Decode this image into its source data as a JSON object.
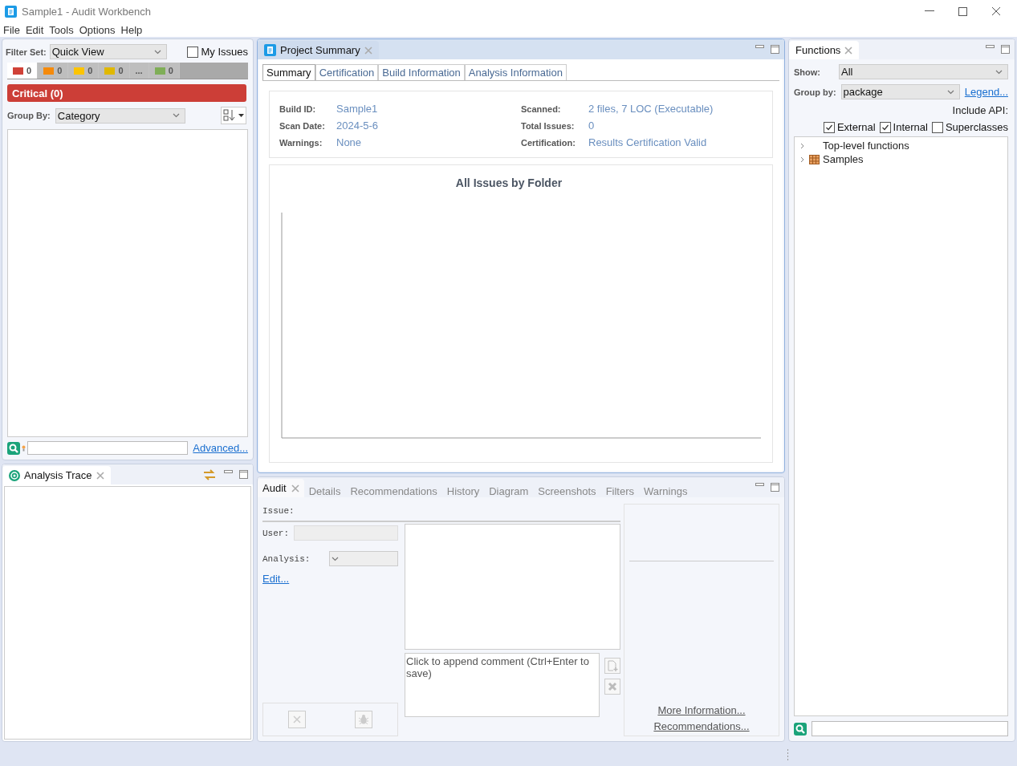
{
  "window": {
    "title": "Sample1 - Audit Workbench"
  },
  "menu": [
    "File",
    "Edit",
    "Tools",
    "Options",
    "Help"
  ],
  "filter_panel": {
    "filter_set_label": "Filter Set:",
    "filter_set": "Quick View",
    "my_issues": {
      "label": "My Issues",
      "checked": false
    },
    "severity_tabs": [
      {
        "kind": "count",
        "color": "#d04238",
        "count": "0",
        "selected": true
      },
      {
        "kind": "count",
        "color": "#f58a0b",
        "count": "0",
        "selected": false
      },
      {
        "kind": "count",
        "color": "#fcc400",
        "count": "0",
        "selected": false
      },
      {
        "kind": "count",
        "color": "#e0b800",
        "count": "0",
        "selected": false
      },
      {
        "kind": "more",
        "label": "...",
        "selected": false
      },
      {
        "kind": "count",
        "color": "#7fae57",
        "count": "0",
        "selected": false
      }
    ],
    "banner": "Critical (0)",
    "group_by_label": "Group By:",
    "group_by": "Category",
    "advanced_link": "Advanced..."
  },
  "analysis_trace": {
    "title": "Analysis Trace"
  },
  "project_summary": {
    "title": "Project Summary",
    "tabs": [
      {
        "label": "Summary",
        "selected": true
      },
      {
        "label": "Certification",
        "selected": false
      },
      {
        "label": "Build Information",
        "selected": false
      },
      {
        "label": "Analysis Information",
        "selected": false
      }
    ],
    "fields_left": [
      {
        "label": "Build ID:",
        "value": "Sample1"
      },
      {
        "label": "Scan Date:",
        "value": "2024-5-6"
      },
      {
        "label": "Warnings:",
        "value": "None"
      }
    ],
    "fields_right": [
      {
        "label": "Scanned:",
        "value": "2 files, 7 LOC (Executable)"
      },
      {
        "label": "Total Issues:",
        "value": "0"
      },
      {
        "label": "Certification:",
        "value": "Results Certification Valid"
      }
    ],
    "chart_title": "All Issues by Folder"
  },
  "audit_panel": {
    "tabs": [
      {
        "label": "Audit",
        "selected": true
      },
      {
        "label": "Details",
        "selected": false
      },
      {
        "label": "Recommendations",
        "selected": false
      },
      {
        "label": "History",
        "selected": false
      },
      {
        "label": "Diagram",
        "selected": false
      },
      {
        "label": "Screenshots",
        "selected": false
      },
      {
        "label": "Filters",
        "selected": false
      },
      {
        "label": "Warnings",
        "selected": false
      }
    ],
    "issue_label": "Issue:",
    "user_label": "User:",
    "analysis_label": "Analysis:",
    "edit_link": "Edit...",
    "comment_placeholder": "Click to append comment (Ctrl+Enter to save)",
    "more_info_link": "More Information...",
    "recommendations_link": "Recommendations..."
  },
  "functions_panel": {
    "title": "Functions",
    "show_label": "Show:",
    "show": "All",
    "group_by_label": "Group by:",
    "group_by": "package",
    "legend_link": "Legend...",
    "include_api_label": "Include API:",
    "include_options": [
      {
        "label": "External",
        "checked": true
      },
      {
        "label": "Internal",
        "checked": true
      },
      {
        "label": "Superclasses",
        "checked": false
      }
    ],
    "tree": [
      {
        "kind": "folder",
        "label": "Top-level functions",
        "expanded": false
      },
      {
        "kind": "package",
        "label": "Samples",
        "expanded": false
      }
    ]
  }
}
